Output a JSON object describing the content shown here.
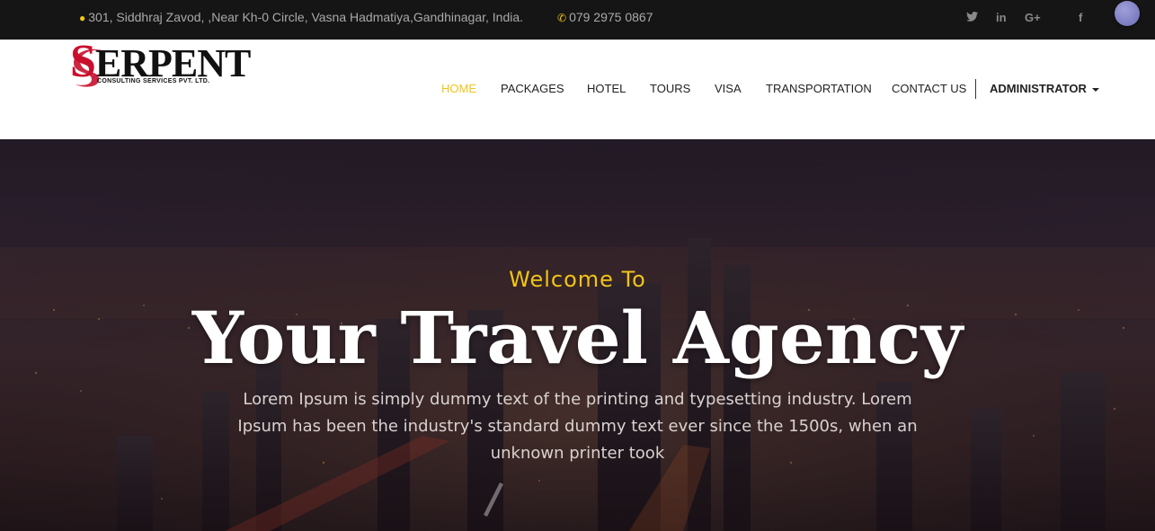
{
  "topbar": {
    "address": "301, Siddhraj Zavod, ,Near Kh-0 Circle, Vasna Hadmatiya,Gandhinagar, India.",
    "phone": "079 2975 0867",
    "social": {
      "twitter": "🐦",
      "linkedin": "in",
      "googleplus": "G+",
      "facebook": "f"
    }
  },
  "logo": {
    "wordmark_first": "S",
    "wordmark_rest": "ERPENT",
    "tagline": "CONSULTING SERVICES PVT. LTD."
  },
  "nav": {
    "home": "HOME",
    "packages": "PACKAGES",
    "hotel": "HOTEL",
    "tours": "TOURS",
    "visa": "VISA",
    "transportation": "TRANSPORTATION",
    "contact": "CONTACT US",
    "admin": "ADMINISTRATOR"
  },
  "hero": {
    "welcome": "Welcome To",
    "title": "Your Travel Agency",
    "text": "Lorem Ipsum is simply dummy text of the printing and typesetting industry. Lorem Ipsum has been the industry's standard dummy text ever since the 1500s, when an unknown printer took"
  },
  "colors": {
    "accent": "#f0c419",
    "topbar_bg": "#151515",
    "header_bg": "#ffffff",
    "logo_red": "#c8102e"
  }
}
